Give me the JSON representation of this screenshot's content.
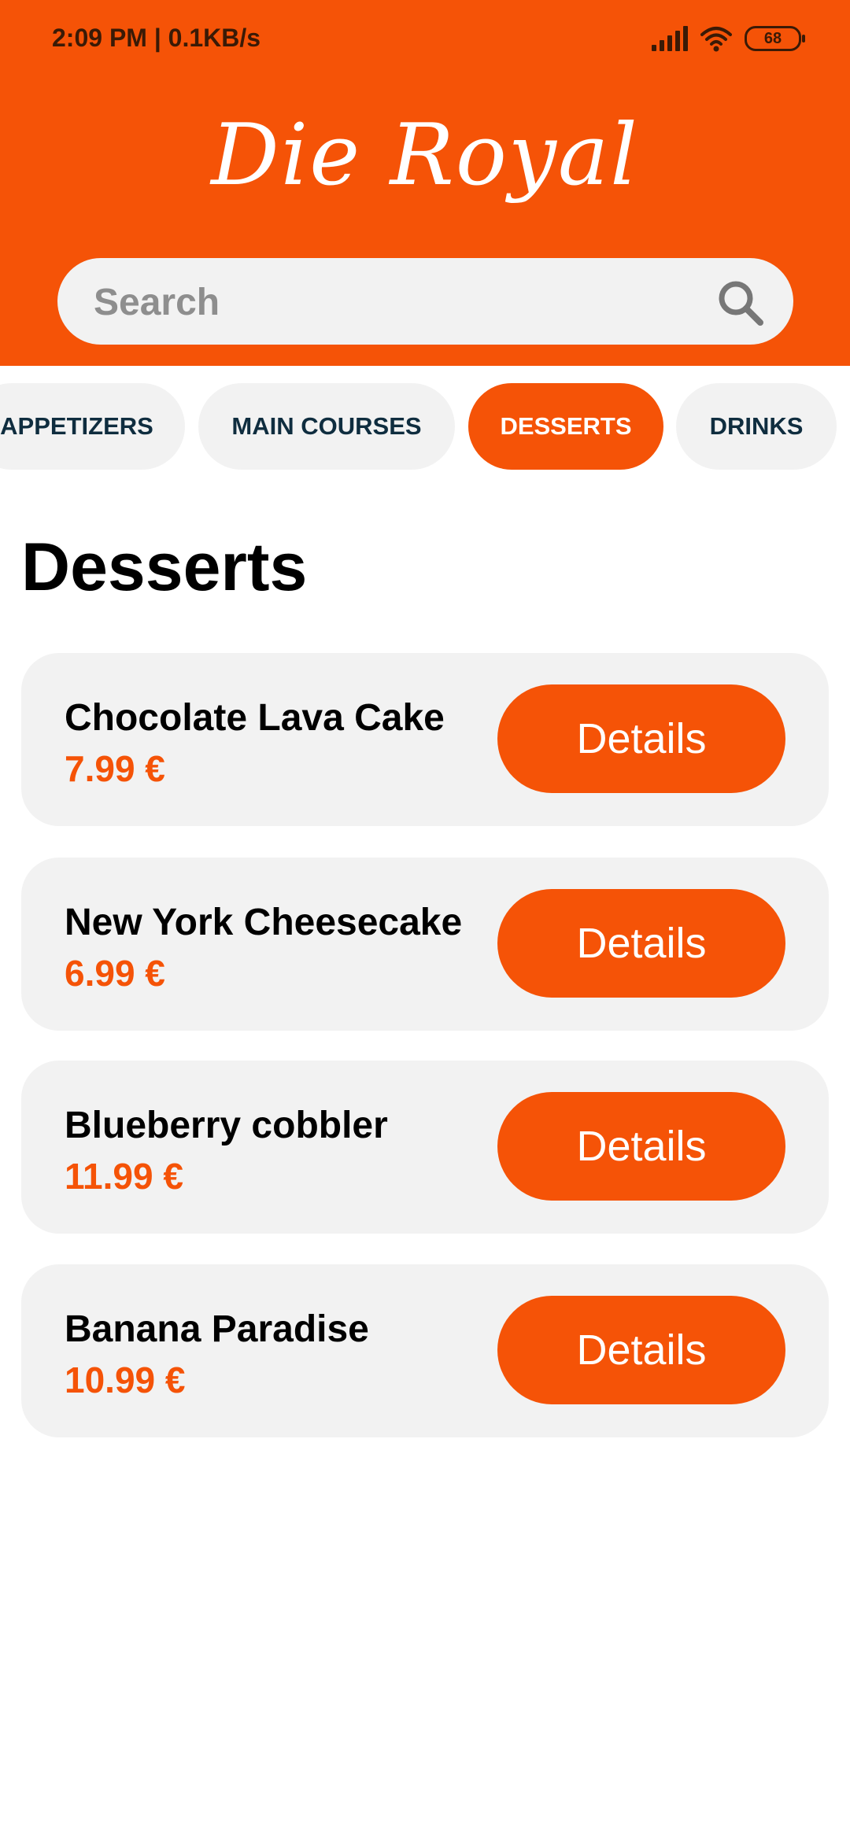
{
  "status_bar": {
    "time_speed": "2:09 PM | 0.1KB/s",
    "battery": "68"
  },
  "header": {
    "title": "Die Royal"
  },
  "search": {
    "placeholder": "Search",
    "icon": "search-icon"
  },
  "categories": [
    {
      "label": "APPETIZERS",
      "active": false
    },
    {
      "label": "MAIN COURSES",
      "active": false
    },
    {
      "label": "DESSERTS",
      "active": true
    },
    {
      "label": "DRINKS",
      "active": false
    }
  ],
  "section": {
    "title": "Desserts"
  },
  "items": [
    {
      "name": "Chocolate Lava Cake",
      "price": "7.99 €",
      "button": "Details"
    },
    {
      "name": "New York Cheesecake",
      "price": "6.99 €",
      "button": "Details"
    },
    {
      "name": "Blueberry cobbler",
      "price": "11.99 €",
      "button": "Details"
    },
    {
      "name": "Banana Paradise",
      "price": "10.99 €",
      "button": "Details"
    }
  ],
  "colors": {
    "accent": "#F55307",
    "card_bg": "#F2F2F2",
    "chip_text": "#0F2D3F"
  }
}
